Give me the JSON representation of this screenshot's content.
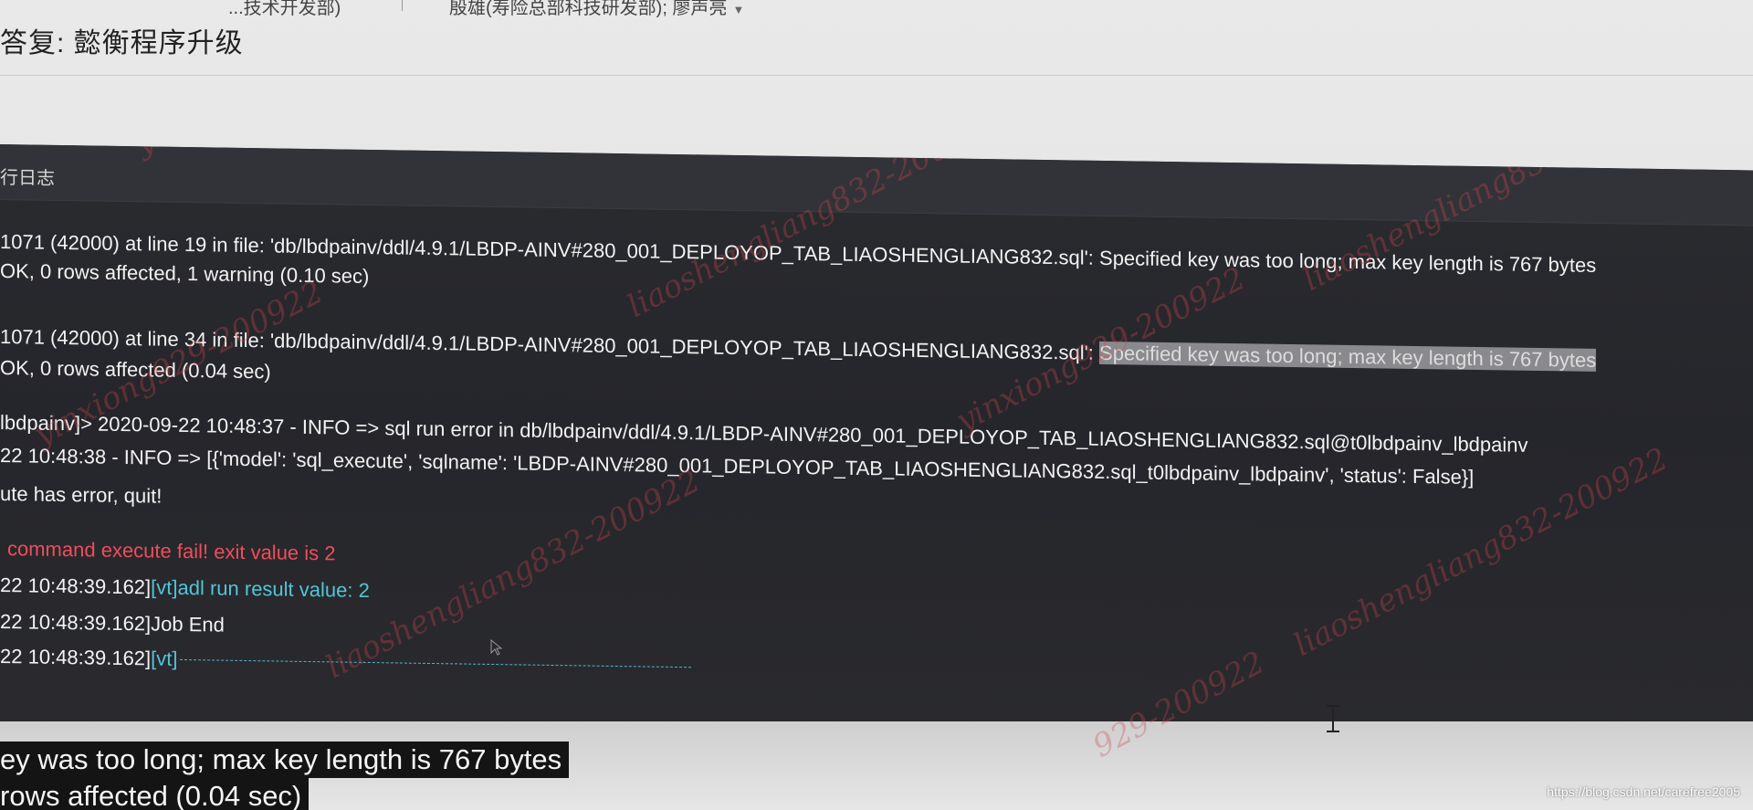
{
  "email": {
    "recipients_left": "...技术开发部)",
    "recipients_right": "殷雄(寿险总部科技研发部); 廖声亮",
    "subject": "答复: 懿衡程序升级"
  },
  "panel": {
    "title": "行日志"
  },
  "log": {
    "line1": "1071 (42000) at line 19 in file: 'db/lbdpainv/ddl/4.9.1/LBDP-AINV#280_001_DEPLOYOP_TAB_LIAOSHENGLIANG832.sql': Specified key was too long; max key length is 767 bytes",
    "line2": "OK, 0 rows affected, 1 warning (0.10 sec)",
    "line3_prefix": "1071 (42000) at line 34 in file: 'db/lbdpainv/ddl/4.9.1/LBDP-AINV#280_001_DEPLOYOP_TAB_LIAOSHENGLIANG832.sql': ",
    "line3_selected": "Specified key was too long; max key length is 767 bytes",
    "line4": "OK, 0 rows affected (0.04 sec)",
    "line5": "lbdpainv]> 2020-09-22 10:48:37 - INFO => sql run error in db/lbdpainv/ddl/4.9.1/LBDP-AINV#280_001_DEPLOYOP_TAB_LIAOSHENGLIANG832.sql@t0lbdpainv_lbdpainv",
    "line6_prefix": "22 10:48:38 - INFO => ",
    "line6_body": "[{'model': 'sql_execute', 'sqlname': 'LBDP-AINV#280_001_DEPLOYOP_TAB_LIAOSHENGLIANG832.sql_t0lbdpainv_lbdpainv', 'status': False}]",
    "line7": "ute has error, quit!",
    "line8": "command execute fail! exit value is 2",
    "line9_time": "22 10:48:39.162]",
    "line9_msg": "[vt]adl run result value: 2",
    "line10": "22 10:48:39.162]Job End",
    "line11_time": "22 10:48:39.162]",
    "line11_tag": "[vt]"
  },
  "bottom": {
    "line1": "ey was too long; max key length is 767 bytes",
    "line2": "rows affected (0.04 sec)"
  },
  "watermarks": [
    "yinxiong929-200922",
    "liaoshengliang832-200922",
    "yinxiong929-200922",
    "liaoshengliang832-200922",
    "liaoshengliang832-200922",
    "liaoshengliang832-200922",
    "yinxiong929-200922",
    "929-200922"
  ],
  "footer_url": "https://blog.csdn.net/carefree2005",
  "colors": {
    "panel_bg": "#26272b",
    "error_red": "#ee4e5a",
    "info_cyan": "#52c5d8",
    "selection_gray": "#8a8a8e",
    "watermark_red": "#d24650"
  }
}
